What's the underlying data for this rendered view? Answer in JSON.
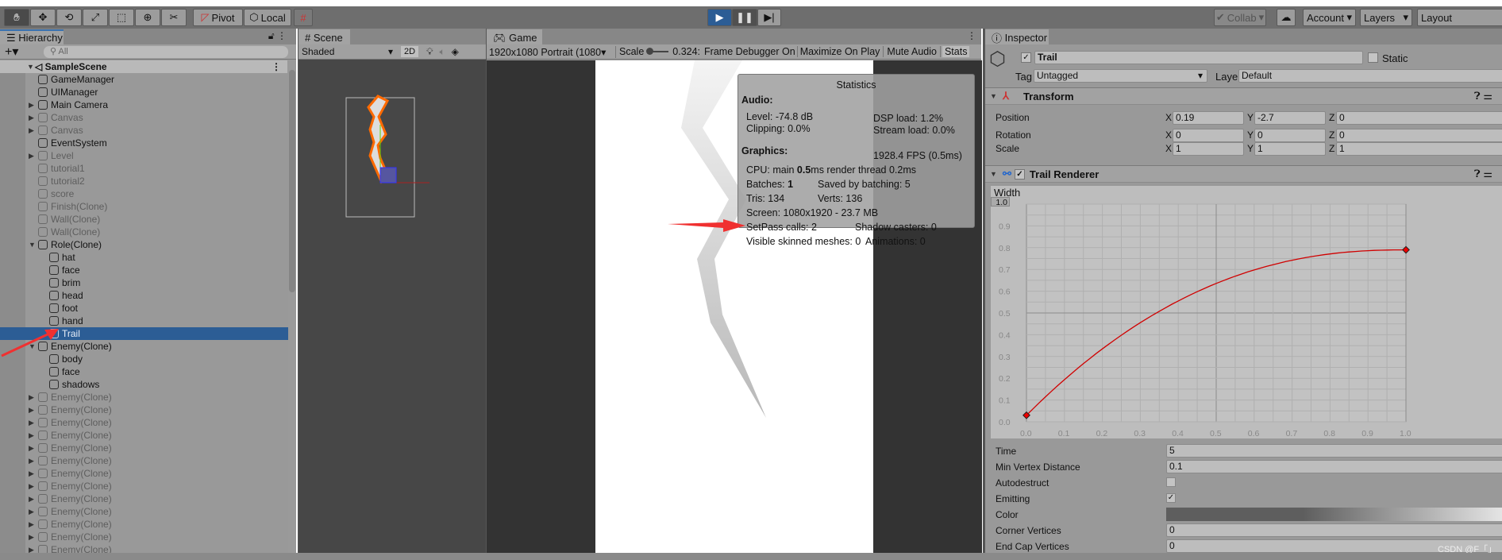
{
  "toolbar": {
    "pivot": "Pivot",
    "local": "Local",
    "collab": "Collab",
    "account": "Account",
    "layers": "Layers",
    "layout": "Layout",
    "tools": [
      "hand-icon",
      "move-icon",
      "rotate-icon",
      "scale-icon",
      "rect-icon",
      "transform-icon",
      "custom-tools-icon"
    ]
  },
  "hierarchy": {
    "tab": "Hierarchy",
    "search_placeholder": "All",
    "scene": "SampleScene",
    "items": [
      {
        "label": "GameManager",
        "depth": 1,
        "active": true,
        "arrow": ""
      },
      {
        "label": "UIManager",
        "depth": 1,
        "active": true,
        "arrow": ""
      },
      {
        "label": "Main Camera",
        "depth": 1,
        "active": true,
        "arrow": "▶"
      },
      {
        "label": "Canvas",
        "depth": 1,
        "active": false,
        "arrow": "▶"
      },
      {
        "label": "Canvas",
        "depth": 1,
        "active": false,
        "arrow": "▶"
      },
      {
        "label": "EventSystem",
        "depth": 1,
        "active": true,
        "arrow": ""
      },
      {
        "label": "Level",
        "depth": 1,
        "active": false,
        "arrow": "▶"
      },
      {
        "label": "tutorial1",
        "depth": 1,
        "active": false,
        "arrow": ""
      },
      {
        "label": "tutorial2",
        "depth": 1,
        "active": false,
        "arrow": ""
      },
      {
        "label": "score",
        "depth": 1,
        "active": false,
        "arrow": ""
      },
      {
        "label": "Finish(Clone)",
        "depth": 1,
        "active": false,
        "arrow": ""
      },
      {
        "label": "Wall(Clone)",
        "depth": 1,
        "active": false,
        "arrow": ""
      },
      {
        "label": "Wall(Clone)",
        "depth": 1,
        "active": false,
        "arrow": ""
      },
      {
        "label": "Role(Clone)",
        "depth": 1,
        "active": true,
        "arrow": "▼"
      },
      {
        "label": "hat",
        "depth": 2,
        "active": true,
        "arrow": ""
      },
      {
        "label": "face",
        "depth": 2,
        "active": true,
        "arrow": ""
      },
      {
        "label": "brim",
        "depth": 2,
        "active": true,
        "arrow": ""
      },
      {
        "label": "head",
        "depth": 2,
        "active": true,
        "arrow": ""
      },
      {
        "label": "foot",
        "depth": 2,
        "active": true,
        "arrow": ""
      },
      {
        "label": "hand",
        "depth": 2,
        "active": true,
        "arrow": ""
      },
      {
        "label": "Trail",
        "depth": 2,
        "active": true,
        "arrow": "",
        "selected": true
      },
      {
        "label": "Enemy(Clone)",
        "depth": 1,
        "active": true,
        "arrow": "▼"
      },
      {
        "label": "body",
        "depth": 2,
        "active": true,
        "arrow": ""
      },
      {
        "label": "face",
        "depth": 2,
        "active": true,
        "arrow": ""
      },
      {
        "label": "shadows",
        "depth": 2,
        "active": true,
        "arrow": ""
      },
      {
        "label": "Enemy(Clone)",
        "depth": 1,
        "active": false,
        "arrow": "▶"
      },
      {
        "label": "Enemy(Clone)",
        "depth": 1,
        "active": false,
        "arrow": "▶"
      },
      {
        "label": "Enemy(Clone)",
        "depth": 1,
        "active": false,
        "arrow": "▶"
      },
      {
        "label": "Enemy(Clone)",
        "depth": 1,
        "active": false,
        "arrow": "▶"
      },
      {
        "label": "Enemy(Clone)",
        "depth": 1,
        "active": false,
        "arrow": "▶"
      },
      {
        "label": "Enemy(Clone)",
        "depth": 1,
        "active": false,
        "arrow": "▶"
      },
      {
        "label": "Enemy(Clone)",
        "depth": 1,
        "active": false,
        "arrow": "▶"
      },
      {
        "label": "Enemy(Clone)",
        "depth": 1,
        "active": false,
        "arrow": "▶"
      },
      {
        "label": "Enemy(Clone)",
        "depth": 1,
        "active": false,
        "arrow": "▶"
      },
      {
        "label": "Enemy(Clone)",
        "depth": 1,
        "active": false,
        "arrow": "▶"
      },
      {
        "label": "Enemy(Clone)",
        "depth": 1,
        "active": false,
        "arrow": "▶"
      },
      {
        "label": "Enemy(Clone)",
        "depth": 1,
        "active": false,
        "arrow": "▶"
      },
      {
        "label": "Enemy(Clone)",
        "depth": 1,
        "active": false,
        "arrow": "▶"
      }
    ]
  },
  "scene": {
    "tab": "Scene",
    "shading": "Shaded",
    "mode_2d": "2D"
  },
  "game": {
    "tab": "Game",
    "resolution": "1920x1080 Portrait (1080",
    "scale_label": "Scale",
    "scale_value": "0.324:",
    "frame_debugger": "Frame Debugger On",
    "maximize": "Maximize On Play",
    "mute": "Mute Audio",
    "stats": "Stats"
  },
  "statistics": {
    "title": "Statistics",
    "audio": "Audio:",
    "level": "Level: -74.8 dB",
    "clipping": "Clipping: 0.0%",
    "dsp": "DSP load: 1.2%",
    "stream": "Stream load: 0.0%",
    "graphics": "Graphics:",
    "fps": "1928.4 FPS (0.5ms)",
    "cpu_pre": "CPU: main ",
    "cpu_bold": "0.5",
    "cpu_post": "ms  render thread 0.2ms",
    "batches_pre": "Batches: ",
    "batches_bold": "1",
    "saved": "Saved by batching: 5",
    "tris": "Tris: 134",
    "verts": "Verts: 136",
    "screen": "Screen: 1080x1920 - 23.7 MB",
    "setpass": "SetPass calls: 2",
    "shadow": "Shadow casters: 0",
    "skinned": "Visible skinned meshes: 0",
    "animations": "Animations: 0"
  },
  "inspector": {
    "tab": "Inspector",
    "name": "Trail",
    "static": "Static",
    "tag_label": "Tag",
    "tag": "Untagged",
    "layer_label": "Layer",
    "layer": "Default",
    "transform": {
      "title": "Transform",
      "rows": [
        {
          "label": "Position",
          "x": "0.19",
          "y": "-2.7",
          "z": "0"
        },
        {
          "label": "Rotation",
          "x": "0",
          "y": "0",
          "z": "0"
        },
        {
          "label": "Scale",
          "x": "1",
          "y": "1",
          "z": "1"
        }
      ]
    },
    "trail": {
      "title": "Trail Renderer",
      "width_label": "Width",
      "y_max_field": "1.0",
      "y_ticks": [
        "0.9",
        "0.8",
        "0.7",
        "0.6",
        "0.5",
        "0.4",
        "0.3",
        "0.2",
        "0.1",
        "0.0"
      ],
      "x_ticks": [
        "0.0",
        "0.1",
        "0.2",
        "0.3",
        "0.4",
        "0.5",
        "0.6",
        "0.7",
        "0.8",
        "0.9",
        "1.0"
      ],
      "curve_keys": [
        {
          "time": 0.0,
          "value": 0.03
        },
        {
          "time": 1.0,
          "value": 0.79
        }
      ],
      "props": [
        {
          "label": "Time",
          "value": "5",
          "kind": "field"
        },
        {
          "label": "Min Vertex Distance",
          "value": "0.1",
          "kind": "field"
        },
        {
          "label": "Autodestruct",
          "value": "",
          "kind": "checkbox",
          "checked": false
        },
        {
          "label": "Emitting",
          "value": "",
          "kind": "checkbox",
          "checked": true
        },
        {
          "label": "Color",
          "value": "",
          "kind": "gradient"
        },
        {
          "label": "Corner Vertices",
          "value": "0",
          "kind": "field"
        },
        {
          "label": "End Cap Vertices",
          "value": "0",
          "kind": "field"
        }
      ]
    }
  },
  "watermark": "CSDN @F「」",
  "colors": {
    "selection": "#2c5d95",
    "curve": "#d00000",
    "accent": "#3a72b0",
    "annotation_arrow": "#f03030"
  }
}
